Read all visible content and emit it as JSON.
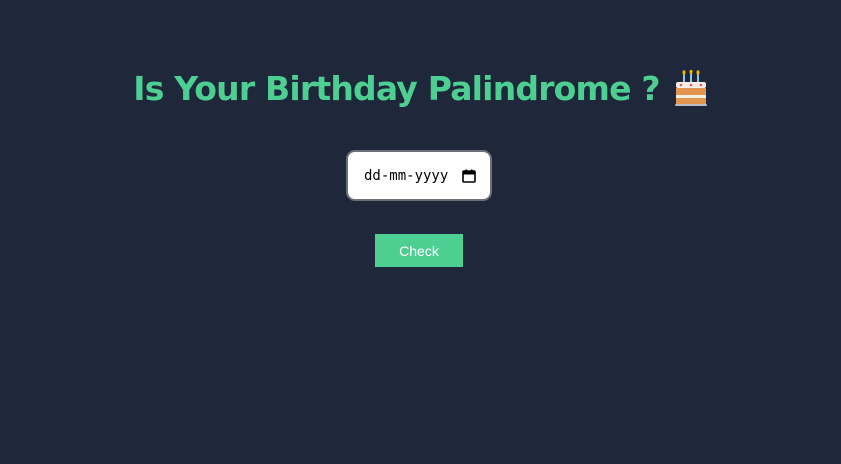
{
  "header": {
    "title": "Is Your Birthday Palindrome ?",
    "title_icon": "birthday-cake-icon",
    "title_color": "#4ecf92"
  },
  "date_input": {
    "placeholder": "dd-mm-yyyy",
    "value": "",
    "icon": "calendar-icon"
  },
  "actions": {
    "check_label": "Check"
  },
  "theme": {
    "background": "#1f283a",
    "accent": "#4ecf92"
  }
}
